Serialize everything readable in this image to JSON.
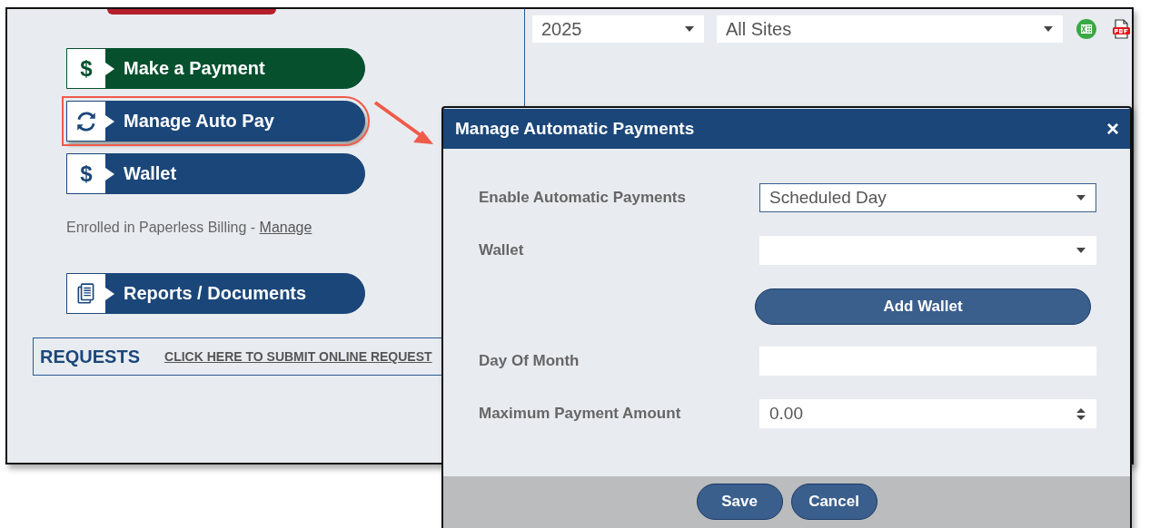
{
  "filters": {
    "year": "2025",
    "site": "All Sites"
  },
  "actions": [
    {
      "kind": "dollar",
      "symbol": "$",
      "label": "Make a Payment",
      "color": "#06502e",
      "highlighted": false
    },
    {
      "kind": "sync",
      "label": "Manage Auto Pay",
      "color": "#1b4679",
      "highlighted": true
    },
    {
      "kind": "dollar",
      "symbol": "$",
      "label": "Wallet",
      "color": "#1b4679",
      "highlighted": false
    }
  ],
  "paperless": {
    "text": "Enrolled in Paperless Billing - ",
    "link": "Manage"
  },
  "reports": {
    "kind": "documents",
    "label": "Reports / Documents",
    "color": "#1b4679"
  },
  "requests": {
    "title": "REQUESTS",
    "link": "CLICK HERE TO SUBMIT ONLINE REQUEST"
  },
  "dialog": {
    "title": "Manage Automatic Payments",
    "close": "×",
    "fields": [
      {
        "kind": "select",
        "label": "Enable Automatic Payments",
        "value": "Scheduled Day",
        "focused": true
      },
      {
        "kind": "select",
        "label": "Wallet",
        "focused": false
      },
      {
        "kind": "button",
        "label": "Add Wallet"
      },
      {
        "kind": "text",
        "label": "Day Of Month",
        "focused": false
      },
      {
        "kind": "number",
        "label": "Maximum Payment Amount",
        "value": "0.00",
        "focused": false
      }
    ],
    "buttons": [
      "Save",
      "Cancel"
    ]
  }
}
